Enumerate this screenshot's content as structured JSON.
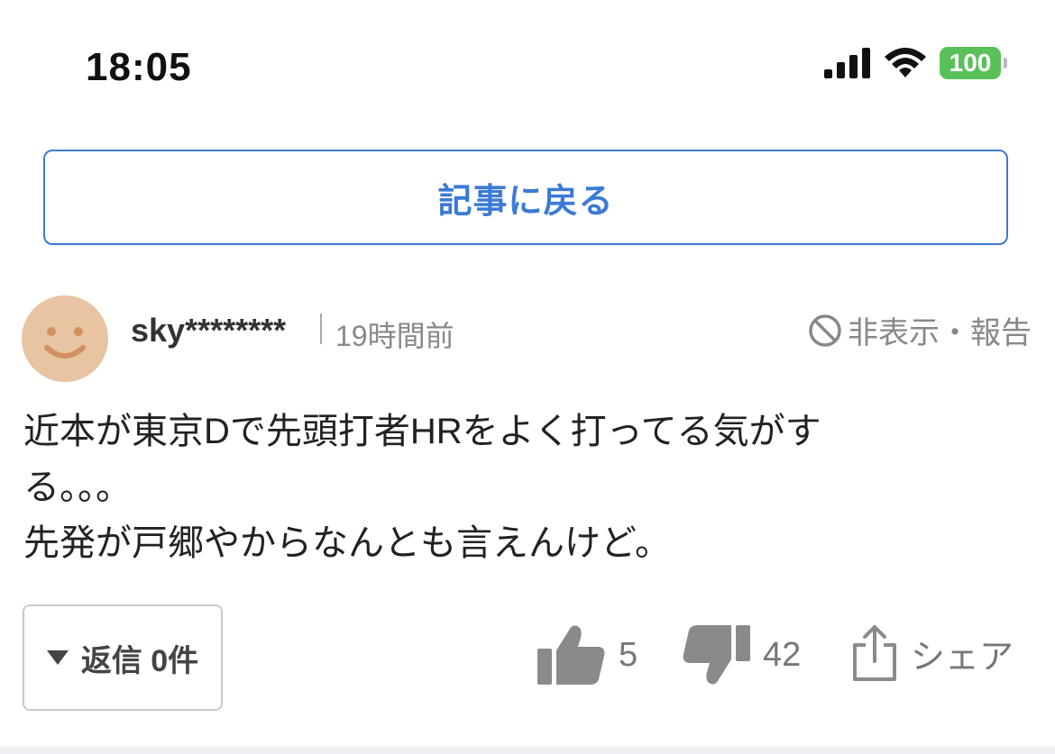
{
  "status_bar": {
    "time": "18:05",
    "battery": "100"
  },
  "back_button": {
    "label": "記事に戻る"
  },
  "comment": {
    "username": "sky********",
    "timestamp": "19時間前",
    "hide_report": "非表示・報告",
    "body_lines": [
      "近本が東京Dで先頭打者HRをよく打ってる気がす",
      "る。。。",
      "先発が戸郷やからなんとも言えんけど。"
    ],
    "replies_label": "返信 0件",
    "likes": "5",
    "dislikes": "42",
    "share_label": "シェア"
  },
  "colors": {
    "accent": "#3b7ad6",
    "avatar": "#e8c4a2",
    "battery": "#5ac15a",
    "icon_gray": "#8a8a8a"
  },
  "icons": [
    "signal-icon",
    "wifi-icon",
    "battery-icon",
    "avatar-smiley-icon",
    "prohibit-icon",
    "triangle-down-icon",
    "thumbs-up-icon",
    "thumbs-down-icon",
    "share-icon"
  ]
}
